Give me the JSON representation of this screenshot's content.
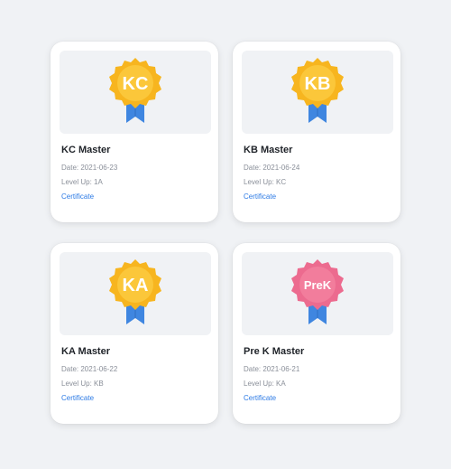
{
  "colors": {
    "page_bg": "#f0f2f5",
    "card_bg": "#ffffff",
    "gold_badge": "#f7b51f",
    "pink_badge": "#ec6b8f",
    "ribbon_blue": "#3f86e0",
    "link": "#2d7be5"
  },
  "cards": [
    {
      "badge_text": "KC",
      "badge_color": "gold",
      "title": "KC Master",
      "date": "Date: 2021-06-23",
      "level": "Level Up: 1A",
      "link": "Certificate"
    },
    {
      "badge_text": "KB",
      "badge_color": "gold",
      "title": "KB Master",
      "date": "Date: 2021-06-24",
      "level": "Level Up: KC",
      "link": "Certificate"
    },
    {
      "badge_text": "KA",
      "badge_color": "gold",
      "title": "KA Master",
      "date": "Date: 2021-06-22",
      "level": "Level Up: KB",
      "link": "Certificate"
    },
    {
      "badge_text": "PreK",
      "badge_color": "pink",
      "title": "Pre K Master",
      "date": "Date: 2021-06-21",
      "level": "Level Up: KA",
      "link": "Certificate"
    }
  ]
}
